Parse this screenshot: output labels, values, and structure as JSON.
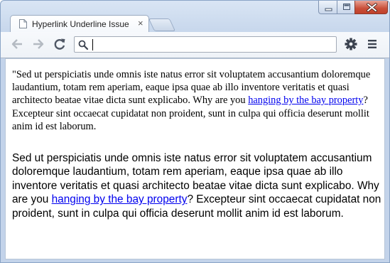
{
  "window": {
    "controls": [
      "minimize-icon",
      "maximize-icon",
      "close-icon"
    ]
  },
  "tabs": [
    {
      "title": "Hyperlink Underline Issue",
      "favicon": "page-icon",
      "close_glyph": "×"
    }
  ],
  "toolbar": {
    "back_icon": "back-arrow-icon",
    "forward_icon": "forward-arrow-icon",
    "reload_icon": "reload-icon",
    "settings_icon": "gear-icon",
    "menu_icon": "hamburger-menu-icon"
  },
  "omnibox": {
    "icon": "search-icon",
    "value": ""
  },
  "content": {
    "serif_paragraph": {
      "before": "\"Sed ut perspiciatis unde omnis iste natus error sit voluptatem accusantium doloremque laudantium, totam rem aperiam, eaque ipsa quae ab illo inventore veritatis et quasi architecto beatae vitae dicta sunt explicabo. Why are you ",
      "link": "hanging by the bay property",
      "after": "? Excepteur sint occaecat cupidatat non proident, sunt in culpa qui officia deserunt mollit anim id est laborum."
    },
    "sans_paragraph": {
      "before": "Sed ut perspiciatis unde omnis iste natus error sit voluptatem accusantium doloremque laudantium, totam rem aperiam, eaque ipsa quae ab illo inventore veritatis et quasi architecto beatae vitae dicta sunt explicabo. Why are you ",
      "link": "hanging by the bay property",
      "after": "? Excepteur sint occaecat cupidatat non proident, sunt in culpa qui officia deserunt mollit anim id est laborum."
    }
  },
  "colors": {
    "link": "#0000ee",
    "frame": "#c7d7ec",
    "close_button": "#c9503a"
  }
}
